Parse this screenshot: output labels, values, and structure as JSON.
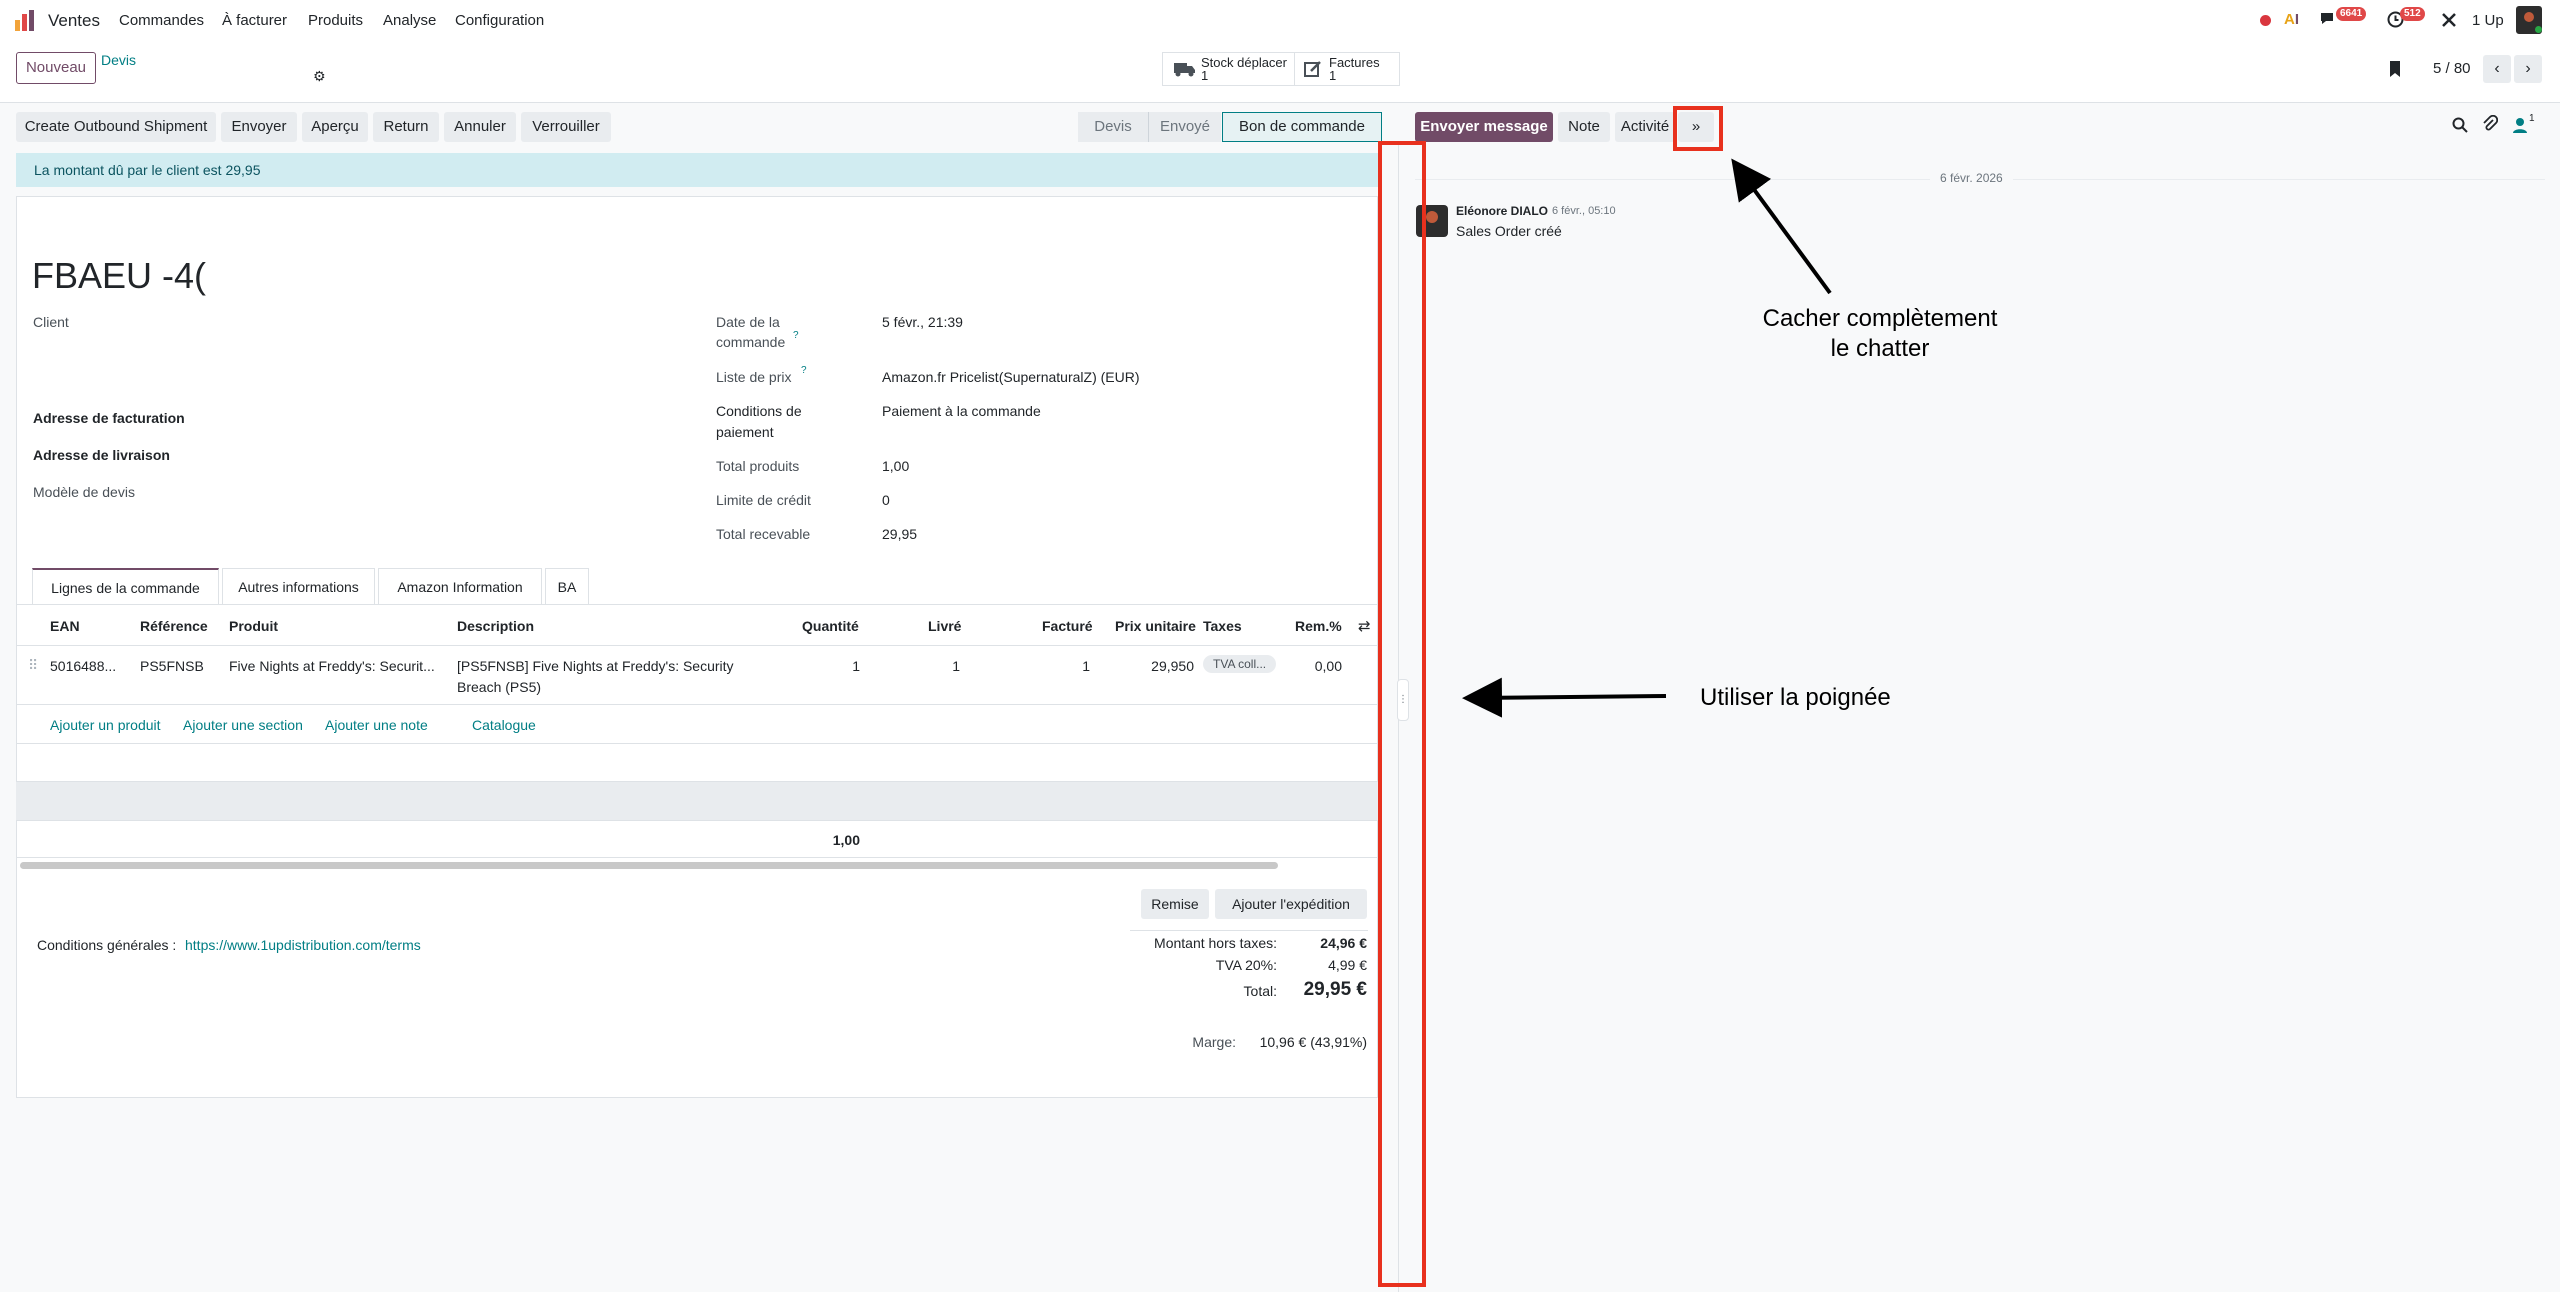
{
  "nav": {
    "app": "Ventes",
    "menus": [
      "Commandes",
      "À facturer",
      "Produits",
      "Analyse",
      "Configuration"
    ],
    "badge_messages": "6641",
    "badge_activities": "512",
    "company": "1 Up"
  },
  "control": {
    "new_button": "Nouveau",
    "breadcrumb": "Devis",
    "smart_stock_label": "Stock déplacer",
    "smart_stock_count": "1",
    "smart_invoices_label": "Factures",
    "smart_invoices_count": "1",
    "pager": "5 / 80"
  },
  "actions": [
    "Create Outbound Shipment",
    "Envoyer",
    "Aperçu",
    "Return",
    "Annuler",
    "Verrouiller"
  ],
  "statusbar": [
    "Devis",
    "Envoyé",
    "Bon de commande"
  ],
  "alert": "La montant dû par le client est 29,95",
  "form": {
    "name": "FBAEU -4(",
    "left_labels": {
      "client": "Client",
      "billing": "Adresse de facturation",
      "shipping": "Adresse de livraison",
      "template": "Modèle de devis"
    },
    "right": {
      "order_date_label_1": "Date de la",
      "order_date_label_2": "commande",
      "order_date": "5 févr., 21:39",
      "pricelist_label": "Liste de prix",
      "pricelist": "Amazon.fr Pricelist(SupernaturalZ) (EUR)",
      "payment_label_1": "Conditions de",
      "payment_label_2": "paiement",
      "payment": "Paiement à la commande",
      "total_products_label": "Total produits",
      "total_products": "1,00",
      "credit_limit_label": "Limite de crédit",
      "credit_limit": "0",
      "receivable_label": "Total recevable",
      "receivable": "29,95"
    }
  },
  "tabs": [
    "Lignes de la commande",
    "Autres informations",
    "Amazon Information",
    "BA"
  ],
  "lines": {
    "headers": [
      "EAN",
      "Référence",
      "Produit",
      "Description",
      "Quantité",
      "Livré",
      "Facturé",
      "Prix unitaire",
      "Taxes",
      "Rem.%"
    ],
    "row": {
      "ean": "5016488...",
      "ref": "PS5FNSB",
      "product": "Five Nights at Freddy's: Securit...",
      "desc_1": "[PS5FNSB] Five Nights at Freddy's: Security",
      "desc_2": "Breach (PS5)",
      "qty": "1",
      "delivered": "1",
      "invoiced": "1",
      "price": "29,950",
      "tax": "TVA coll...",
      "discount": "0,00"
    },
    "add_links": [
      "Ajouter un produit",
      "Ajouter une section",
      "Ajouter une note",
      "Catalogue"
    ],
    "total_qty": "1,00"
  },
  "footer": {
    "discount_btn": "Remise",
    "shipping_btn": "Ajouter l'expédition",
    "terms_label": "Conditions générales : ",
    "terms_link": "https://www.1updistribution.com/terms",
    "untaxed_label": "Montant hors taxes:",
    "untaxed": "24,96 €",
    "tax_label": "TVA 20%:",
    "tax": "4,99 €",
    "total_label": "Total:",
    "total": "29,95 €",
    "margin_label": "Marge:",
    "margin": "10,96 € (43,91%)"
  },
  "chatter": {
    "send_message": "Envoyer message",
    "note": "Note",
    "activity": "Activité",
    "collapse": "»",
    "followers_count": "1",
    "date_separator": "6 févr. 2026",
    "author": "Eléonore DIALO",
    "msg_time": "6 févr., 05:10",
    "msg_body": "Sales Order créé"
  },
  "annotations": {
    "hide_chatter_1": "Cacher complètement",
    "hide_chatter_2": "le chatter",
    "use_handle": "Utiliser la poignée"
  },
  "colors": {
    "primary": "#714b67",
    "link": "#017e84",
    "annotation": "#e8311e",
    "alert_bg": "#d1ecf1"
  }
}
